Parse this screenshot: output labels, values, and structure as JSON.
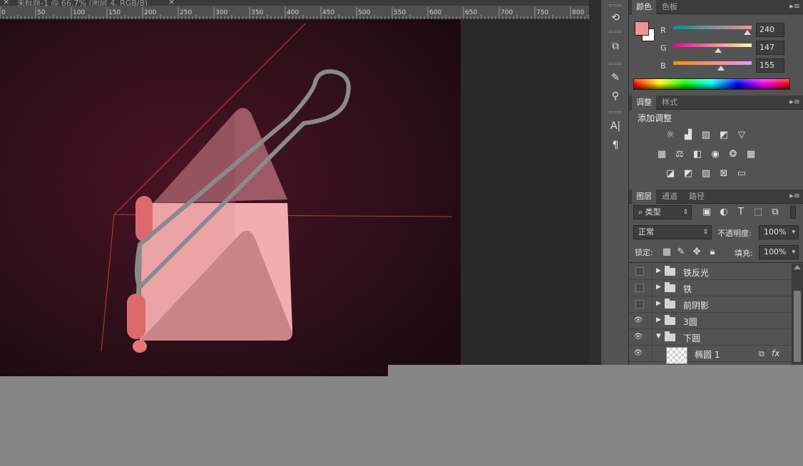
{
  "document_tab": {
    "title": "未标题-1 @ 66.7% (图层 4, RGB/8)",
    "close": "×"
  },
  "ruler": {
    "labels": [
      "0",
      "50",
      "100",
      "150",
      "200",
      "250",
      "300",
      "350",
      "400",
      "450",
      "500",
      "550",
      "600",
      "650",
      "700",
      "750",
      "800"
    ]
  },
  "tools": {
    "icons": [
      "history-icon",
      "3d-icon",
      "brush-preset-icon",
      "clone-source-icon",
      "character-icon",
      "paragraph-icon"
    ],
    "char_glyph": "A|",
    "para_glyph": "¶"
  },
  "color_panel": {
    "tabs": [
      "颜色",
      "色板"
    ],
    "foreground": "#f09398",
    "background": "#ffffff",
    "channels": [
      {
        "label": "R",
        "value": "240",
        "fraction": 0.941
      },
      {
        "label": "G",
        "value": "147",
        "fraction": 0.576
      },
      {
        "label": "B",
        "value": "155",
        "fraction": 0.608
      }
    ]
  },
  "adjust_panel": {
    "tabs": [
      "调整",
      "样式"
    ],
    "heading": "添加调整"
  },
  "layers_panel": {
    "tabs": [
      "图层",
      "通道",
      "路径"
    ],
    "filter_kind": "类型",
    "blend_mode": "正常",
    "opacity_label": "不透明度:",
    "opacity_value": "100%",
    "lock_label": "锁定:",
    "fill_label": "填充:",
    "fill_value": "100%",
    "layers": [
      {
        "name": "铁反光",
        "visible": false,
        "type": "group",
        "expanded": false
      },
      {
        "name": "铁",
        "visible": false,
        "type": "group",
        "expanded": false
      },
      {
        "name": "前阴影",
        "visible": false,
        "type": "group",
        "expanded": false
      },
      {
        "name": "3圆",
        "visible": true,
        "type": "group",
        "expanded": false
      },
      {
        "name": "下圆",
        "visible": true,
        "type": "group",
        "expanded": true
      },
      {
        "name": "椭圆 1",
        "visible": true,
        "type": "layer",
        "fx": "fx"
      }
    ]
  },
  "colors": {
    "canvas_bg": "#2b0c17",
    "pink_light": "#eaa3a6",
    "pink_dark": "#b7707a",
    "red_cyl": "#dc6a6c",
    "wire": "#8a8a8a",
    "guide_line": "#c13a3a"
  }
}
